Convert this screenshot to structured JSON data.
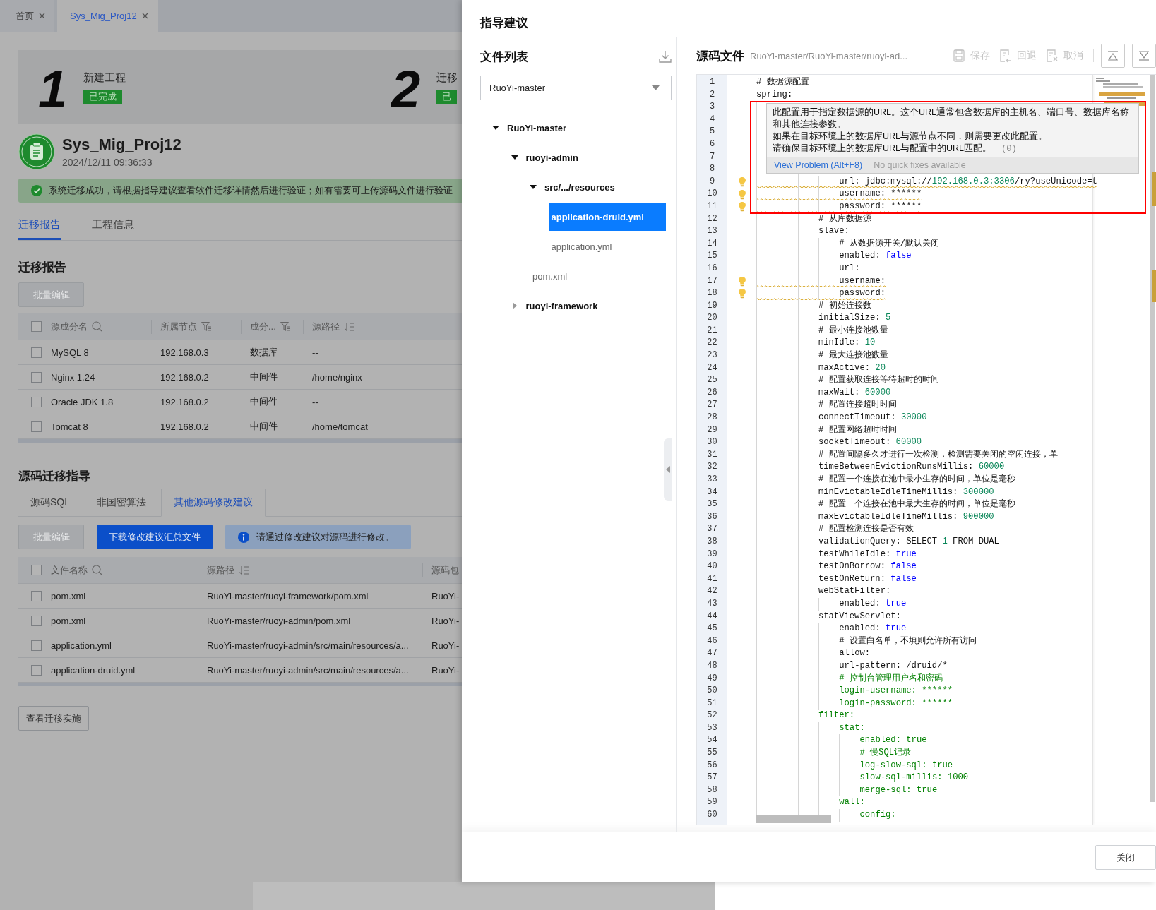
{
  "tabs": [
    {
      "label": "首页",
      "selected": false
    },
    {
      "label": "Sys_Mig_Proj12",
      "selected": true
    }
  ],
  "steps": [
    {
      "number": "1",
      "title": "新建工程",
      "badge": "已完成"
    },
    {
      "number": "2",
      "title": "迁移",
      "badge": "已"
    }
  ],
  "project": {
    "name": "Sys_Mig_Proj12",
    "time": "2024/12/11 09:36:33"
  },
  "alert": "系统迁移成功，请根据指导建议查看软件迁移详情然后进行验证；如有需要可上传源码文件进行验证",
  "view_tabs": [
    {
      "label": "迁移报告",
      "selected": true
    },
    {
      "label": "工程信息",
      "selected": false
    }
  ],
  "report": {
    "title": "迁移报告",
    "batch_button": {
      "label": "批量编辑",
      "disabled": true
    },
    "all_checked": false,
    "columns": [
      "源成分名",
      "所属节点",
      "成分...",
      "源路径"
    ],
    "rows": [
      {
        "checked": false,
        "cells": [
          "MySQL 8",
          "192.168.0.3",
          "数据库",
          "--"
        ]
      },
      {
        "checked": false,
        "cells": [
          "Nginx 1.24",
          "192.168.0.2",
          "中间件",
          "/home/nginx"
        ]
      },
      {
        "checked": false,
        "cells": [
          "Oracle JDK 1.8",
          "192.168.0.2",
          "中间件",
          "--"
        ]
      },
      {
        "checked": false,
        "cells": [
          "Tomcat 8",
          "192.168.0.2",
          "中间件",
          "/home/tomcat"
        ]
      }
    ]
  },
  "guide": {
    "title": "源码迁移指导",
    "tabs": [
      {
        "label": "源码SQL",
        "selected": false
      },
      {
        "label": "非国密算法",
        "selected": false
      },
      {
        "label": "其他源码修改建议",
        "selected": true
      }
    ],
    "batch_button": {
      "label": "批量编辑",
      "disabled": true
    },
    "download_button": "下载修改建议汇总文件",
    "info": "请通过修改建议对源码进行修改。",
    "all_checked": false,
    "columns": [
      "文件名称",
      "源路径",
      "源码包"
    ],
    "rows": [
      {
        "checked": false,
        "cells": [
          "pom.xml",
          "RuoYi-master/ruoyi-framework/pom.xml",
          "RuoYi-"
        ]
      },
      {
        "checked": false,
        "cells": [
          "pom.xml",
          "RuoYi-master/ruoyi-admin/pom.xml",
          "RuoYi-"
        ]
      },
      {
        "checked": false,
        "cells": [
          "application.yml",
          "RuoYi-master/ruoyi-admin/src/main/resources/a...",
          "RuoYi-"
        ]
      },
      {
        "checked": false,
        "cells": [
          "application-druid.yml",
          "RuoYi-master/ruoyi-admin/src/main/resources/a...",
          "RuoYi-"
        ]
      }
    ]
  },
  "implement_button": "查看迁移实施",
  "drawer": {
    "title": "指导建议",
    "file_list": {
      "title": "文件列表",
      "select": "RuoYi-master",
      "tree": [
        {
          "label": "RuoYi-master",
          "kind": "folder",
          "expanded": true,
          "selected": false,
          "children": [
            {
              "label": "ruoyi-admin",
              "kind": "folder",
              "expanded": true,
              "selected": false,
              "children": [
                {
                  "label": "src/.../resources",
                  "kind": "folder",
                  "expanded": true,
                  "selected": false,
                  "children": [
                    {
                      "label": "application-druid.yml",
                      "kind": "file",
                      "selected": true
                    },
                    {
                      "label": "application.yml",
                      "kind": "file",
                      "selected": false
                    }
                  ]
                },
                {
                  "label": "pom.xml",
                  "kind": "file",
                  "selected": false
                }
              ]
            },
            {
              "label": "ruoyi-framework",
              "kind": "folder",
              "expanded": false,
              "selected": false
            }
          ]
        }
      ]
    },
    "source": {
      "title": "源码文件",
      "path": "RuoYi-master/RuoYi-master/ruoyi-ad...",
      "actions": [
        {
          "label": "保存",
          "disabled": true
        },
        {
          "label": "回退",
          "disabled": true
        },
        {
          "label": "取消",
          "disabled": true
        }
      ],
      "lines": [
        {
          "no": "1",
          "warning": false,
          "tokens": [
            {
              "kind": "plain",
              "text": "# 数据源配置"
            }
          ]
        },
        {
          "no": "2",
          "warning": false,
          "tokens": [
            {
              "kind": "plain",
              "text": "spring:"
            }
          ],
          "children": [
            {
              "no": "3",
              "warning": false,
              "children": [
                {
                  "no": "4",
                  "warning": false
                },
                {
                  "no": "5",
                  "warning": false
                },
                {
                  "no": "6",
                  "warning": false,
                  "children": [
                    {
                      "no": "7",
                      "warning": false
                    },
                    {
                      "no": "8",
                      "warning": false,
                      "children": [
                        {
                          "no": "9",
                          "warning": true,
                          "tokens": [
                            {
                              "kind": "plain",
                              "text": "url: jdbc:mysql://"
                            },
                            {
                              "kind": "number",
                              "text": "192.168.0.3:3306"
                            },
                            {
                              "kind": "plain",
                              "text": "/ry?useUnicode=t"
                            }
                          ]
                        },
                        {
                          "no": "10",
                          "warning": true,
                          "tokens": [
                            {
                              "kind": "plain",
                              "text": "username: ******"
                            }
                          ]
                        },
                        {
                          "no": "11",
                          "warning": true,
                          "tokens": [
                            {
                              "kind": "plain",
                              "text": "password: ******"
                            }
                          ]
                        }
                      ]
                    },
                    {
                      "no": "12",
                      "warning": false,
                      "tokens": [
                        {
                          "kind": "plain",
                          "text": "# 从库数据源"
                        }
                      ]
                    },
                    {
                      "no": "13",
                      "warning": false,
                      "tokens": [
                        {
                          "kind": "plain",
                          "text": "slave:"
                        }
                      ],
                      "children": [
                        {
                          "no": "14",
                          "warning": false,
                          "tokens": [
                            {
                              "kind": "plain",
                              "text": "# 从数据源开关/默认关闭"
                            }
                          ]
                        },
                        {
                          "no": "15",
                          "warning": false,
                          "tokens": [
                            {
                              "kind": "plain",
                              "text": "enabled: "
                            },
                            {
                              "kind": "literal",
                              "text": "false"
                            }
                          ]
                        },
                        {
                          "no": "16",
                          "warning": false,
                          "tokens": [
                            {
                              "kind": "plain",
                              "text": "url:"
                            }
                          ]
                        },
                        {
                          "no": "17",
                          "warning": true,
                          "tokens": [
                            {
                              "kind": "plain",
                              "text": "username:"
                            }
                          ]
                        },
                        {
                          "no": "18",
                          "warning": true,
                          "tokens": [
                            {
                              "kind": "plain",
                              "text": "password:"
                            }
                          ]
                        }
                      ]
                    },
                    {
                      "no": "19",
                      "warning": false,
                      "tokens": [
                        {
                          "kind": "plain",
                          "text": "# 初始连接数"
                        }
                      ]
                    },
                    {
                      "no": "20",
                      "warning": false,
                      "tokens": [
                        {
                          "kind": "plain",
                          "text": "initialSize: "
                        },
                        {
                          "kind": "number",
                          "text": "5"
                        }
                      ]
                    },
                    {
                      "no": "21",
                      "warning": false,
                      "tokens": [
                        {
                          "kind": "plain",
                          "text": "# 最小连接池数量"
                        }
                      ]
                    },
                    {
                      "no": "22",
                      "warning": false,
                      "tokens": [
                        {
                          "kind": "plain",
                          "text": "minIdle: "
                        },
                        {
                          "kind": "number",
                          "text": "10"
                        }
                      ]
                    },
                    {
                      "no": "23",
                      "warning": false,
                      "tokens": [
                        {
                          "kind": "plain",
                          "text": "# 最大连接池数量"
                        }
                      ]
                    },
                    {
                      "no": "24",
                      "warning": false,
                      "tokens": [
                        {
                          "kind": "plain",
                          "text": "maxActive: "
                        },
                        {
                          "kind": "number",
                          "text": "20"
                        }
                      ]
                    },
                    {
                      "no": "25",
                      "warning": false,
                      "tokens": [
                        {
                          "kind": "plain",
                          "text": "# 配置获取连接等待超时的时间"
                        }
                      ]
                    },
                    {
                      "no": "26",
                      "warning": false,
                      "tokens": [
                        {
                          "kind": "plain",
                          "text": "maxWait: "
                        },
                        {
                          "kind": "number",
                          "text": "60000"
                        }
                      ]
                    },
                    {
                      "no": "27",
                      "warning": false,
                      "tokens": [
                        {
                          "kind": "plain",
                          "text": "# 配置连接超时时间"
                        }
                      ]
                    },
                    {
                      "no": "28",
                      "warning": false,
                      "tokens": [
                        {
                          "kind": "plain",
                          "text": "connectTimeout: "
                        },
                        {
                          "kind": "number",
                          "text": "30000"
                        }
                      ]
                    },
                    {
                      "no": "29",
                      "warning": false,
                      "tokens": [
                        {
                          "kind": "plain",
                          "text": "# 配置网络超时时间"
                        }
                      ]
                    },
                    {
                      "no": "30",
                      "warning": false,
                      "tokens": [
                        {
                          "kind": "plain",
                          "text": "socketTimeout: "
                        },
                        {
                          "kind": "number",
                          "text": "60000"
                        }
                      ]
                    },
                    {
                      "no": "31",
                      "warning": false,
                      "tokens": [
                        {
                          "kind": "plain",
                          "text": "# 配置间隔多久才进行一次检测，检测需要关闭的空闲连接，单"
                        }
                      ]
                    },
                    {
                      "no": "32",
                      "warning": false,
                      "tokens": [
                        {
                          "kind": "plain",
                          "text": "timeBetweenEvictionRunsMillis: "
                        },
                        {
                          "kind": "number",
                          "text": "60000"
                        }
                      ]
                    },
                    {
                      "no": "33",
                      "warning": false,
                      "tokens": [
                        {
                          "kind": "plain",
                          "text": "# 配置一个连接在池中最小生存的时间，单位是毫秒"
                        }
                      ]
                    },
                    {
                      "no": "34",
                      "warning": false,
                      "tokens": [
                        {
                          "kind": "plain",
                          "text": "minEvictableIdleTimeMillis: "
                        },
                        {
                          "kind": "number",
                          "text": "300000"
                        }
                      ]
                    },
                    {
                      "no": "35",
                      "warning": false,
                      "tokens": [
                        {
                          "kind": "plain",
                          "text": "# 配置一个连接在池中最大生存的时间，单位是毫秒"
                        }
                      ]
                    },
                    {
                      "no": "36",
                      "warning": false,
                      "tokens": [
                        {
                          "kind": "plain",
                          "text": "maxEvictableIdleTimeMillis: "
                        },
                        {
                          "kind": "number",
                          "text": "900000"
                        }
                      ]
                    },
                    {
                      "no": "37",
                      "warning": false,
                      "tokens": [
                        {
                          "kind": "plain",
                          "text": "# 配置检测连接是否有效"
                        }
                      ]
                    },
                    {
                      "no": "38",
                      "warning": false,
                      "tokens": [
                        {
                          "kind": "plain",
                          "text": "validationQuery: SELECT "
                        },
                        {
                          "kind": "number",
                          "text": "1"
                        },
                        {
                          "kind": "plain",
                          "text": " FROM DUAL"
                        }
                      ]
                    },
                    {
                      "no": "39",
                      "warning": false,
                      "tokens": [
                        {
                          "kind": "plain",
                          "text": "testWhileIdle: "
                        },
                        {
                          "kind": "literal",
                          "text": "true"
                        }
                      ]
                    },
                    {
                      "no": "40",
                      "warning": false,
                      "tokens": [
                        {
                          "kind": "plain",
                          "text": "testOnBorrow: "
                        },
                        {
                          "kind": "literal",
                          "text": "false"
                        }
                      ]
                    },
                    {
                      "no": "41",
                      "warning": false,
                      "tokens": [
                        {
                          "kind": "plain",
                          "text": "testOnReturn: "
                        },
                        {
                          "kind": "literal",
                          "text": "false"
                        }
                      ]
                    },
                    {
                      "no": "42",
                      "warning": false,
                      "tokens": [
                        {
                          "kind": "plain",
                          "text": "webStatFilter:"
                        }
                      ],
                      "children": [
                        {
                          "no": "43",
                          "warning": false,
                          "tokens": [
                            {
                              "kind": "plain",
                              "text": "enabled: "
                            },
                            {
                              "kind": "literal",
                              "text": "true"
                            }
                          ]
                        }
                      ]
                    },
                    {
                      "no": "44",
                      "warning": false,
                      "tokens": [
                        {
                          "kind": "plain",
                          "text": "statViewServlet:"
                        }
                      ],
                      "children": [
                        {
                          "no": "45",
                          "warning": false,
                          "tokens": [
                            {
                              "kind": "plain",
                              "text": "enabled: "
                            },
                            {
                              "kind": "literal",
                              "text": "true"
                            }
                          ]
                        },
                        {
                          "no": "46",
                          "warning": false,
                          "tokens": [
                            {
                              "kind": "plain",
                              "text": "# 设置白名单，不填则允许所有访问"
                            }
                          ]
                        },
                        {
                          "no": "47",
                          "warning": false,
                          "tokens": [
                            {
                              "kind": "plain",
                              "text": "allow:"
                            }
                          ]
                        },
                        {
                          "no": "48",
                          "warning": false,
                          "tokens": [
                            {
                              "kind": "plain",
                              "text": "url-pattern: /druid/*"
                            }
                          ]
                        },
                        {
                          "no": "49",
                          "warning": false,
                          "tokens": [
                            {
                              "kind": "comment",
                              "text": "# 控制台管理用户名和密码"
                            }
                          ]
                        },
                        {
                          "no": "50",
                          "warning": false,
                          "tokens": [
                            {
                              "kind": "comment",
                              "text": "login-username: ******"
                            }
                          ]
                        },
                        {
                          "no": "51",
                          "warning": false,
                          "tokens": [
                            {
                              "kind": "comment",
                              "text": "login-password: ******"
                            }
                          ]
                        }
                      ]
                    },
                    {
                      "no": "52",
                      "warning": false,
                      "tokens": [
                        {
                          "kind": "comment",
                          "text": "filter:"
                        }
                      ],
                      "children": [
                        {
                          "no": "53",
                          "warning": false,
                          "tokens": [
                            {
                              "kind": "comment",
                              "text": "stat:"
                            }
                          ],
                          "children": [
                            {
                              "no": "54",
                              "warning": false,
                              "tokens": [
                                {
                                  "kind": "comment",
                                  "text": "enabled: true"
                                }
                              ]
                            },
                            {
                              "no": "55",
                              "warning": false,
                              "tokens": [
                                {
                                  "kind": "comment",
                                  "text": "# 慢SQL记录"
                                }
                              ]
                            },
                            {
                              "no": "56",
                              "warning": false,
                              "tokens": [
                                {
                                  "kind": "comment",
                                  "text": "log-slow-sql: true"
                                }
                              ]
                            },
                            {
                              "no": "57",
                              "warning": false,
                              "tokens": [
                                {
                                  "kind": "comment",
                                  "text": "slow-sql-millis: 1000"
                                }
                              ]
                            },
                            {
                              "no": "58",
                              "warning": false,
                              "tokens": [
                                {
                                  "kind": "comment",
                                  "text": "merge-sql: true"
                                }
                              ]
                            }
                          ]
                        },
                        {
                          "no": "59",
                          "warning": false,
                          "tokens": [
                            {
                              "kind": "comment",
                              "text": "wall:"
                            }
                          ],
                          "children": [
                            {
                              "no": "60",
                              "warning": false,
                              "tokens": [
                                {
                                  "kind": "comment",
                                  "text": "config:"
                                }
                              ]
                            }
                          ]
                        }
                      ]
                    }
                  ]
                }
              ]
            }
          ]
        }
      ],
      "hover": {
        "messages": [
          "此配置用于指定数据源的URL。这个URL通常包含数据库的主机名、端口号、数据库名称和其他连接参数。",
          "如果在目标环境上的数据库URL与源节点不同，则需要更改此配置。",
          "请确保目标环境上的数据库URL与配置中的URL匹配。"
        ],
        "count": "(0)",
        "link": "View Problem (Alt+F8)",
        "note": "No quick fixes available"
      }
    },
    "close_button": "关闭"
  }
}
